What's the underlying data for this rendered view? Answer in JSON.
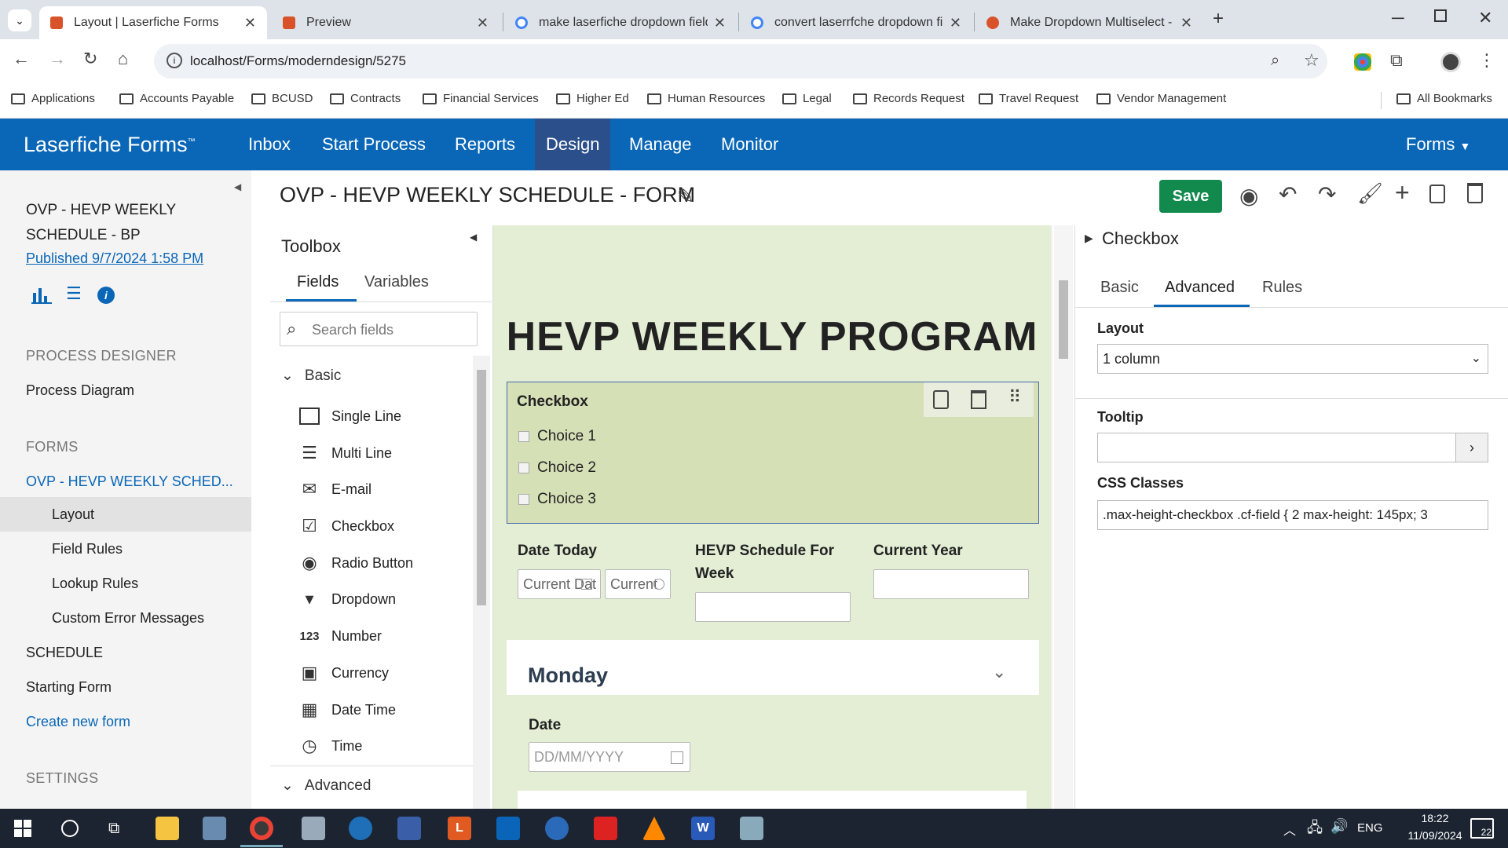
{
  "browser": {
    "tabs": [
      {
        "title": "Layout | Laserfiche Forms",
        "color": "#d9532a"
      },
      {
        "title": "Preview",
        "color": "#d9532a"
      },
      {
        "title": "make laserfiche dropdown field",
        "color": "#4285f4"
      },
      {
        "title": "convert laserrfche dropdown fie",
        "color": "#4285f4"
      },
      {
        "title": "Make Dropdown Multiselect - L",
        "color": "#d9532a"
      }
    ],
    "url": "localhost/Forms/moderndesign/5275",
    "bookmarks": [
      "Applications",
      "Accounts Payable",
      "BCUSD",
      "Contracts",
      "Financial Services",
      "Higher Ed",
      "Human Resources",
      "Legal",
      "Records Request",
      "Travel Request",
      "Vendor Management"
    ],
    "all_bookmarks": "All Bookmarks"
  },
  "app": {
    "brand": "Laserfiche Forms",
    "tm": "™",
    "nav": [
      "Inbox",
      "Start Process",
      "Reports",
      "Design",
      "Manage",
      "Monitor"
    ],
    "forms_menu": "Forms",
    "accent": "#0a67b7"
  },
  "leftnav": {
    "process_title_1": "OVP - HEVP WEEKLY",
    "process_title_2": "SCHEDULE - BP",
    "published": "Published 9/7/2024 1:58 PM",
    "process_designer": "PROCESS DESIGNER",
    "process_diagram": "Process Diagram",
    "forms": "FORMS",
    "current_form": "OVP - HEVP WEEKLY SCHED...",
    "layout": "Layout",
    "field_rules": "Field Rules",
    "lookup_rules": "Lookup Rules",
    "custom_errors": "Custom Error Messages",
    "schedule": "SCHEDULE",
    "starting_form": "Starting Form",
    "create_new": "Create new form",
    "settings": "SETTINGS"
  },
  "editor": {
    "form_title": "OVP - HEVP WEEKLY SCHEDULE - FORM",
    "save": "Save",
    "save_color": "#128a4e"
  },
  "toolbox": {
    "title": "Toolbox",
    "tabs": [
      "Fields",
      "Variables"
    ],
    "search_placeholder": "Search fields",
    "basic": "Basic",
    "advanced": "Advanced",
    "items": [
      {
        "label": "Single Line",
        "icon": "single-line-icon"
      },
      {
        "label": "Multi Line",
        "icon": "multi-line-icon"
      },
      {
        "label": "E-mail",
        "icon": "email-icon"
      },
      {
        "label": "Checkbox",
        "icon": "checkbox-icon"
      },
      {
        "label": "Radio Button",
        "icon": "radio-icon"
      },
      {
        "label": "Dropdown",
        "icon": "dropdown-icon"
      },
      {
        "label": "Number",
        "icon": "number-icon"
      },
      {
        "label": "Currency",
        "icon": "currency-icon"
      },
      {
        "label": "Date Time",
        "icon": "date-time-icon"
      },
      {
        "label": "Time",
        "icon": "time-icon"
      }
    ]
  },
  "form": {
    "heading": "HEVP WEEKLY PROGRAM",
    "checkbox_label": "Checkbox",
    "choices": [
      "Choice 1",
      "Choice 2",
      "Choice 3"
    ],
    "date_today": "Date Today",
    "current_date_ph": "Current Dat",
    "current_time_ph": "Current",
    "schedule_week_1": "HEVP Schedule For",
    "schedule_week_2": "Week",
    "current_year": "Current Year",
    "monday": "Monday",
    "date": "Date",
    "date_ph": "DD/MM/YYYY",
    "bg": "#e3eed5"
  },
  "props": {
    "title": "Checkbox",
    "tabs": [
      "Basic",
      "Advanced",
      "Rules"
    ],
    "layout_label": "Layout",
    "layout_value": "1 column",
    "tooltip_label": "Tooltip",
    "css_label": "CSS Classes",
    "css_value": ".max-height-checkbox .cf-field { 2    max-height: 145px; 3"
  },
  "taskbar": {
    "lang": "ENG",
    "time": "18:22",
    "date": "11/09/2024",
    "notif": "22"
  }
}
